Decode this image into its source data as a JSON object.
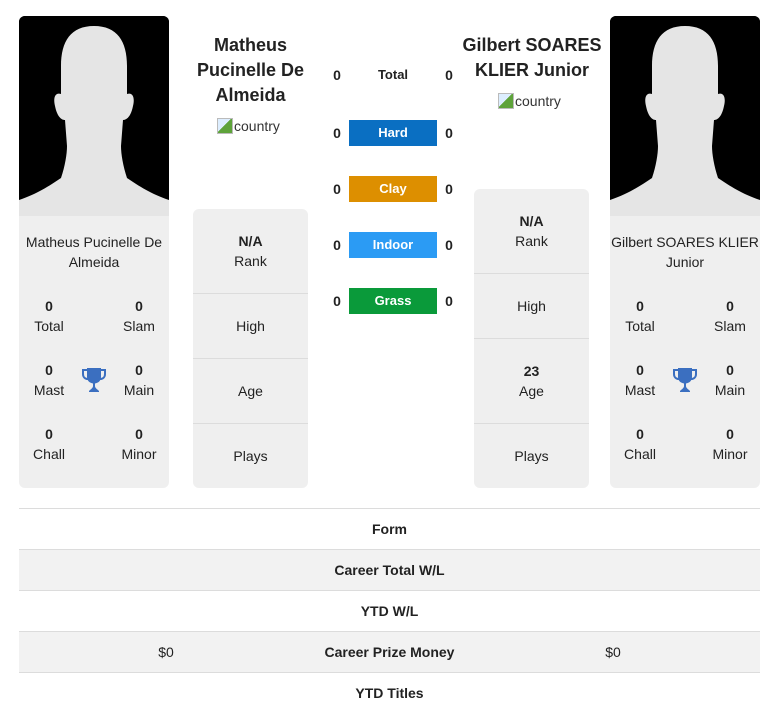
{
  "players": [
    {
      "name": "Matheus Pucinelle De Almeida",
      "header_name": "Matheus Pucinelle De Almeida",
      "country_alt": "country",
      "titles": {
        "total": {
          "value": "0",
          "label": "Total"
        },
        "slam": {
          "value": "0",
          "label": "Slam"
        },
        "mast": {
          "value": "0",
          "label": "Mast"
        },
        "main": {
          "value": "0",
          "label": "Main"
        },
        "chall": {
          "value": "0",
          "label": "Chall"
        },
        "minor": {
          "value": "0",
          "label": "Minor"
        }
      },
      "info": {
        "rank": {
          "value": "N/A",
          "label": "Rank"
        },
        "high": {
          "value": "",
          "label": "High"
        },
        "age": {
          "value": "",
          "label": "Age"
        },
        "plays": {
          "value": "",
          "label": "Plays"
        }
      }
    },
    {
      "name": "Gilbert SOARES KLIER Junior",
      "header_name": "Gilbert SOARES KLIER Junior",
      "country_alt": "country",
      "titles": {
        "total": {
          "value": "0",
          "label": "Total"
        },
        "slam": {
          "value": "0",
          "label": "Slam"
        },
        "mast": {
          "value": "0",
          "label": "Mast"
        },
        "main": {
          "value": "0",
          "label": "Main"
        },
        "chall": {
          "value": "0",
          "label": "Chall"
        },
        "minor": {
          "value": "0",
          "label": "Minor"
        }
      },
      "info": {
        "rank": {
          "value": "N/A",
          "label": "Rank"
        },
        "high": {
          "value": "",
          "label": "High"
        },
        "age": {
          "value": "23",
          "label": "Age"
        },
        "plays": {
          "value": "",
          "label": "Plays"
        }
      }
    }
  ],
  "surfaces": [
    {
      "label": "Total",
      "left": "0",
      "right": "0",
      "color": ""
    },
    {
      "label": "Hard",
      "left": "0",
      "right": "0",
      "color": "#0a6fc2"
    },
    {
      "label": "Clay",
      "left": "0",
      "right": "0",
      "color": "#dd8f00"
    },
    {
      "label": "Indoor",
      "left": "0",
      "right": "0",
      "color": "#2b9bf4"
    },
    {
      "label": "Grass",
      "left": "0",
      "right": "0",
      "color": "#0a9a3a"
    }
  ],
  "comparison": [
    {
      "label": "Form",
      "left": "",
      "right": ""
    },
    {
      "label": "Career Total W/L",
      "left": "",
      "right": ""
    },
    {
      "label": "YTD W/L",
      "left": "",
      "right": ""
    },
    {
      "label": "Career Prize Money",
      "left": "$0",
      "right": "$0"
    },
    {
      "label": "YTD Titles",
      "left": "",
      "right": ""
    }
  ],
  "icons": {
    "trophy": "trophy-icon",
    "trophy_color": "#3b6fc0"
  }
}
